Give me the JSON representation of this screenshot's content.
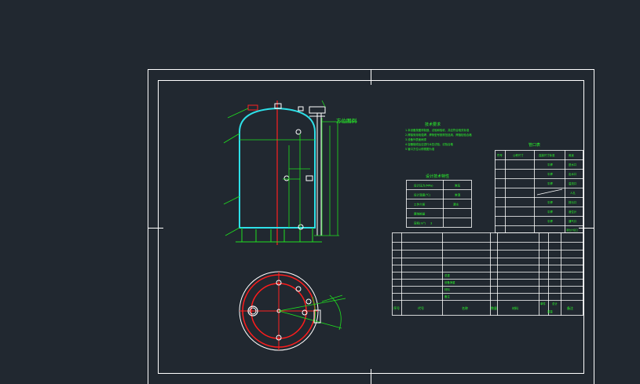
{
  "colors": {
    "background": "#212830",
    "frame": "#ffffff",
    "vessel_outline": "#2ee0e8",
    "dimension": "#1fe01f",
    "centerline": "#ff2020",
    "nozzle": "#ffffff",
    "text": "#2bff2b",
    "red_circle": "#ff1c1c"
  },
  "drawing": {
    "view_label_side": "方位图例",
    "notes_title": "技术要求",
    "notes": [
      "1.本设备按图样制造、试验和验收，并应符合相关标准",
      "2.焊接采用电弧焊，焊条型号按规范选用，焊缝检验合格",
      "3.设备外表面刷漆",
      "4.容器制成后应进行水压试验，试验合格",
      "5.管口方位以俯视图为准"
    ],
    "spec_title": "设计技术特性",
    "spec_rows": [
      [
        "设计压力(MPa)",
        "常压"
      ],
      [
        "设计温度(℃)",
        "常温"
      ],
      [
        "工作介质",
        "清水"
      ],
      [
        "腐蚀裕量",
        ""
      ],
      [
        "容积(m³)",
        "3"
      ]
    ],
    "nozzle_title": "管口表",
    "nozzle_header": [
      "符号",
      "公称尺寸",
      "连接尺寸标准",
      "用途"
    ],
    "nozzle_rows": [
      [
        "",
        "",
        "平焊",
        "进水口"
      ],
      [
        "",
        "",
        "平焊",
        "出水口"
      ],
      [
        "",
        "",
        "平焊",
        "溢流口"
      ],
      [
        "",
        "",
        "",
        "人孔"
      ],
      [
        "",
        "",
        "平焊",
        "排污口"
      ],
      [
        "",
        "",
        "平焊",
        "液位计"
      ],
      [
        "",
        "",
        "平焊",
        "通气口"
      ],
      [
        "",
        "",
        "",
        "液位计接口"
      ]
    ],
    "bom_labels": [
      "总重",
      "设备净重",
      "材料",
      "备注"
    ],
    "bom_header": [
      "序号",
      "代号",
      "名称",
      "数量",
      "材料",
      "单件",
      "总计",
      "备注"
    ],
    "bom_header_sub": "重量"
  }
}
